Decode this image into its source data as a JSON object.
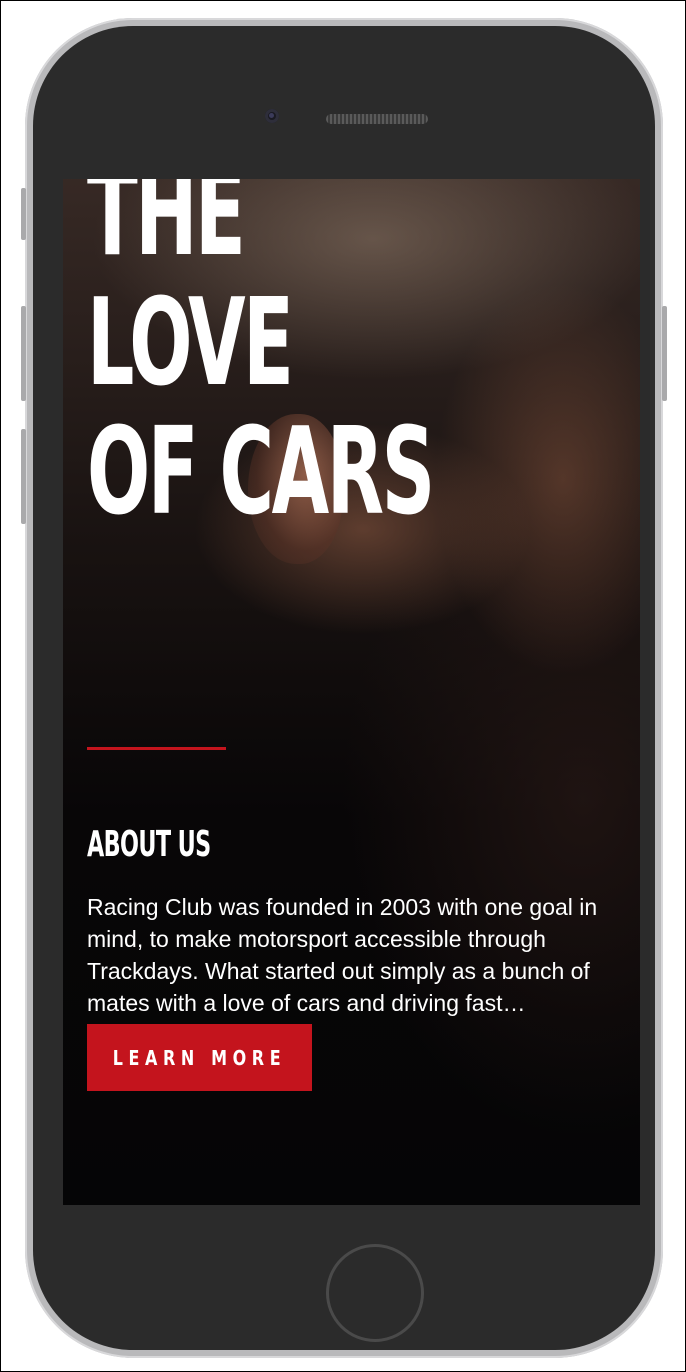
{
  "hero": {
    "line1": "THE",
    "line2": "LOVE",
    "line3": "OF CARS"
  },
  "about": {
    "heading": "ABOUT US",
    "body": "Racing Club was founded in 2003 with one goal in mind, to make motorsport accessible through Trackdays. What started out simply as a bunch of mates with a love of cars and driving fast…",
    "button_label": "LEARN MORE"
  },
  "colors": {
    "accent": "#c4141d",
    "text": "#ffffff",
    "background": "#050506"
  }
}
